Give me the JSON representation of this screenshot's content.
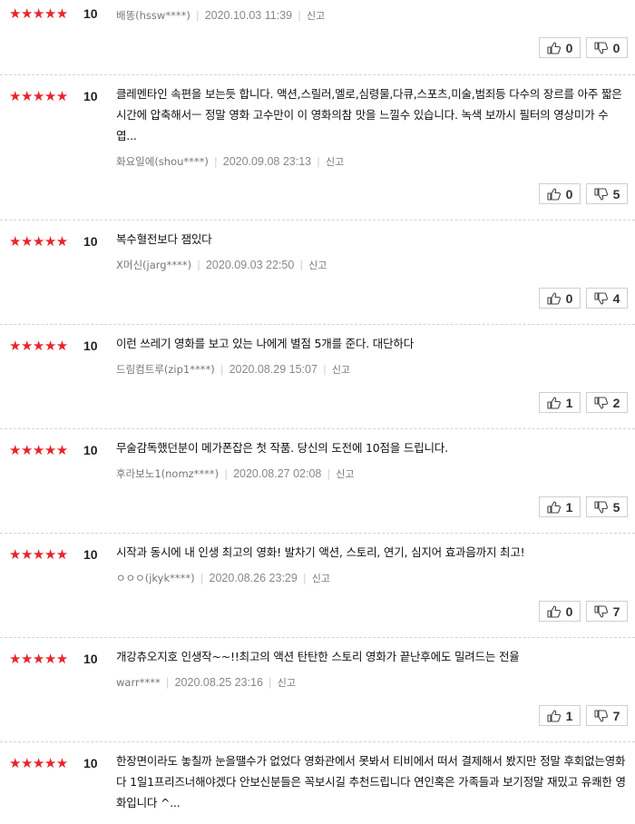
{
  "icons": {
    "star": "star-icon",
    "thumb_up": "thumb-up-icon",
    "thumb_down": "thumb-down-icon"
  },
  "colors": {
    "star": "#e8242c",
    "meta_text": "#888888",
    "divider": "#d4d4d4",
    "button_border": "#cfcfcf"
  },
  "report_label": "신고",
  "reviews": [
    {
      "stars": "★★★★★",
      "rating": 5,
      "score": "10",
      "comment": "",
      "author": "배똥(hssw****)",
      "date": "2020.10.03 11:39",
      "likes": "0",
      "dislikes": "0"
    },
    {
      "stars": "★★★★★",
      "rating": 5,
      "score": "10",
      "comment": "클레멘타인 속편을 보는듯 합니다. 액션,스릴러,멜로,심령물,다큐,스포츠,미술,범죄등 다수의 장르를 아주 짧은 시간에 압축해서ㅡ 정말 영화 고수만이 이 영화의참 맛을 느낄수 있습니다. 녹색 보까시 필터의 영상미가 수엽...",
      "author": "화요일에(shou****)",
      "date": "2020.09.08 23:13",
      "likes": "0",
      "dislikes": "5"
    },
    {
      "stars": "★★★★★",
      "rating": 5,
      "score": "10",
      "comment": "복수혈전보다 잼있다",
      "author": "X머신(jarg****)",
      "date": "2020.09.03 22:50",
      "likes": "0",
      "dislikes": "4"
    },
    {
      "stars": "★★★★★",
      "rating": 5,
      "score": "10",
      "comment": "이런 쓰레기 영화를 보고 있는 나에게 별점 5개를 준다. 대단하다",
      "author": "드림컴트루(zip1****)",
      "date": "2020.08.29 15:07",
      "likes": "1",
      "dislikes": "2"
    },
    {
      "stars": "★★★★★",
      "rating": 5,
      "score": "10",
      "comment": "무술감독했던분이 메가폰잡은 첫 작품. 당신의 도전에 10점을 드립니다.",
      "author": "후라보노1(nomz****)",
      "date": "2020.08.27 02:08",
      "likes": "1",
      "dislikes": "5"
    },
    {
      "stars": "★★★★★",
      "rating": 5,
      "score": "10",
      "comment": "시작과 동시에 내 인생 최고의 영화! 발차기 액션, 스토리, 연기, 심지어 효과음까지 최고!",
      "author": "ㅇㅇㅇ(jkyk****)",
      "date": "2020.08.26 23:29",
      "likes": "0",
      "dislikes": "7"
    },
    {
      "stars": "★★★★★",
      "rating": 5,
      "score": "10",
      "comment": "개강츄오지호 인생작~~!!최고의 액션 탄탄한 스토리 영화가 끝난후에도 밀려드는 전율",
      "author": "warr****",
      "date": "2020.08.25 23:16",
      "likes": "1",
      "dislikes": "7"
    },
    {
      "stars": "★★★★★",
      "rating": 5,
      "score": "10",
      "comment": "한장면이라도 놓칠까 눈을땔수가 없었다 영화관에서 못봐서 티비에서 떠서 결제해서 봤지만 정말 후회없는영화다 1일1프리즈너해야겠다 안보신분들은 꼭보시길 추천드립니다 연인혹은 가족들과 보기정말 재밌고 유쾌한 영화입니다 ^...",
      "author": "",
      "date": "",
      "likes": "",
      "dislikes": ""
    }
  ]
}
